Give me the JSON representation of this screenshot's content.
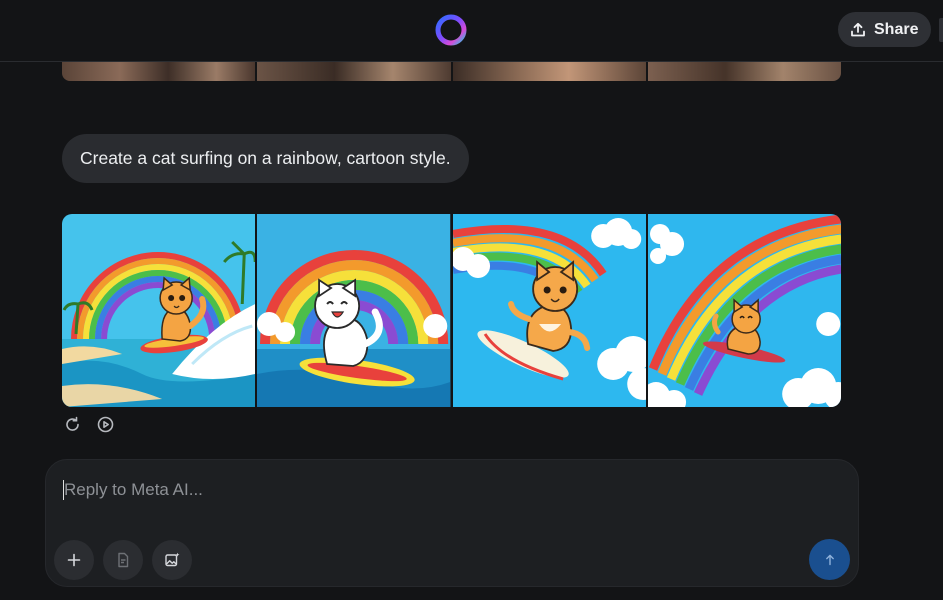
{
  "header": {
    "logo_icon": "meta-ai-ring-icon",
    "share_label": "Share",
    "share_icon": "share-upload-icon"
  },
  "conversation": {
    "previous_images_strip": {
      "image_count": 4,
      "description_icon": "image-thumbnail"
    },
    "user_message": "Create a cat surfing on a rainbow, cartoon style.",
    "generated_images": [
      {
        "icon": "cat-surfing-wave-image"
      },
      {
        "icon": "white-cat-surfboard-image"
      },
      {
        "icon": "cat-jumping-surfboard-image"
      },
      {
        "icon": "cat-rainbow-surf-image"
      }
    ],
    "actions": [
      {
        "icon": "regenerate-icon"
      },
      {
        "icon": "animate-play-icon"
      }
    ]
  },
  "composer": {
    "placeholder": "Reply to Meta AI...",
    "value": "",
    "tools": [
      {
        "icon": "plus-icon"
      },
      {
        "icon": "document-icon"
      },
      {
        "icon": "image-edit-icon"
      }
    ],
    "send_icon": "arrow-up-icon"
  },
  "colors": {
    "background": "#131416",
    "bubble": "#2a2c30",
    "composer": "#1d1f22",
    "send_button": "#1a4f8f",
    "sky": "#3ec0ea",
    "rainbow_red": "#e8413c",
    "cat_orange": "#f4a443"
  }
}
